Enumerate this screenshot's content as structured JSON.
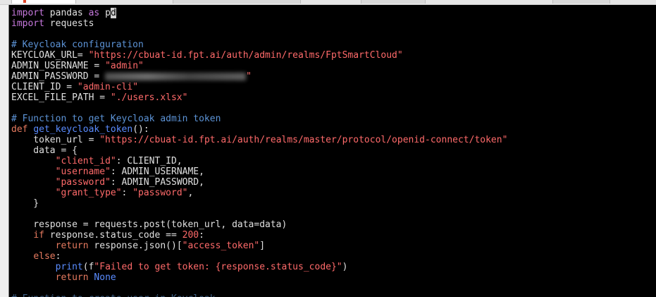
{
  "editor": {
    "lines": [
      {
        "segments": [
          {
            "t": "import",
            "c": "kw"
          },
          {
            "t": " pandas ",
            "c": "fn"
          },
          {
            "t": "as",
            "c": "kw"
          },
          {
            "t": " p",
            "c": "fn"
          },
          {
            "t": "d",
            "c": "cursor"
          }
        ]
      },
      {
        "segments": [
          {
            "t": "import",
            "c": "kw"
          },
          {
            "t": " requests",
            "c": "fn"
          }
        ]
      },
      {
        "segments": []
      },
      {
        "segments": [
          {
            "t": "# Keycloak configuration",
            "c": "cm"
          }
        ]
      },
      {
        "segments": [
          {
            "t": "KEYCLOAK_URL= ",
            "c": "fn"
          },
          {
            "t": "\"https://cbuat-id.fpt.ai/auth/admin/realms/FptSmartCloud\"",
            "c": "st"
          }
        ]
      },
      {
        "segments": [
          {
            "t": "ADMIN_USERNAME = ",
            "c": "fn"
          },
          {
            "t": "\"admin\"",
            "c": "st"
          }
        ]
      },
      {
        "segments": [
          {
            "t": "ADMIN_PASSWORD = ",
            "c": "fn"
          },
          {
            "t": "",
            "c": "blur"
          },
          {
            "t": "\"",
            "c": "st"
          }
        ]
      },
      {
        "segments": [
          {
            "t": "CLIENT_ID = ",
            "c": "fn"
          },
          {
            "t": "\"admin-cli\"",
            "c": "st"
          }
        ]
      },
      {
        "segments": [
          {
            "t": "EXCEL_FILE_PATH = ",
            "c": "fn"
          },
          {
            "t": "\"./users.xlsx\"",
            "c": "st"
          }
        ]
      },
      {
        "segments": []
      },
      {
        "segments": [
          {
            "t": "# Function to get Keycloak admin token",
            "c": "cm"
          }
        ]
      },
      {
        "segments": [
          {
            "t": "def",
            "c": "kw2"
          },
          {
            "t": " ",
            "c": "fn"
          },
          {
            "t": "get_keycloak_token",
            "c": "call"
          },
          {
            "t": "():",
            "c": "fn"
          }
        ]
      },
      {
        "segments": [
          {
            "t": "    token_url = ",
            "c": "fn"
          },
          {
            "t": "\"https://cbuat-id.fpt.ai/auth/realms/master/protocol/openid-connect/token\"",
            "c": "st"
          }
        ]
      },
      {
        "segments": [
          {
            "t": "    data = {",
            "c": "fn"
          }
        ]
      },
      {
        "segments": [
          {
            "t": "        ",
            "c": "fn"
          },
          {
            "t": "\"client_id\"",
            "c": "st"
          },
          {
            "t": ": CLIENT_ID,",
            "c": "fn"
          }
        ]
      },
      {
        "segments": [
          {
            "t": "        ",
            "c": "fn"
          },
          {
            "t": "\"username\"",
            "c": "st"
          },
          {
            "t": ": ADMIN_USERNAME,",
            "c": "fn"
          }
        ]
      },
      {
        "segments": [
          {
            "t": "        ",
            "c": "fn"
          },
          {
            "t": "\"password\"",
            "c": "st"
          },
          {
            "t": ": ADMIN_PASSWORD,",
            "c": "fn"
          }
        ]
      },
      {
        "segments": [
          {
            "t": "        ",
            "c": "fn"
          },
          {
            "t": "\"grant_type\"",
            "c": "st"
          },
          {
            "t": ": ",
            "c": "fn"
          },
          {
            "t": "\"password\"",
            "c": "st"
          },
          {
            "t": ",",
            "c": "fn"
          }
        ]
      },
      {
        "segments": [
          {
            "t": "    }",
            "c": "fn"
          }
        ]
      },
      {
        "segments": []
      },
      {
        "segments": [
          {
            "t": "    response = requests.post(token_url, data=data)",
            "c": "fn"
          }
        ]
      },
      {
        "segments": [
          {
            "t": "    ",
            "c": "fn"
          },
          {
            "t": "if",
            "c": "kw2"
          },
          {
            "t": " response.status_code == ",
            "c": "fn"
          },
          {
            "t": "200",
            "c": "num"
          },
          {
            "t": ":",
            "c": "fn"
          }
        ]
      },
      {
        "segments": [
          {
            "t": "        ",
            "c": "fn"
          },
          {
            "t": "return",
            "c": "kw2"
          },
          {
            "t": " response.json()[",
            "c": "fn"
          },
          {
            "t": "\"access_token\"",
            "c": "st"
          },
          {
            "t": "]",
            "c": "fn"
          }
        ]
      },
      {
        "segments": [
          {
            "t": "    ",
            "c": "fn"
          },
          {
            "t": "else",
            "c": "kw2"
          },
          {
            "t": ":",
            "c": "fn"
          }
        ]
      },
      {
        "segments": [
          {
            "t": "        ",
            "c": "fn"
          },
          {
            "t": "print",
            "c": "call"
          },
          {
            "t": "(f",
            "c": "fn"
          },
          {
            "t": "\"Failed to get token: {response.status_code}\"",
            "c": "st"
          },
          {
            "t": ")",
            "c": "fn"
          }
        ]
      },
      {
        "segments": [
          {
            "t": "        ",
            "c": "fn"
          },
          {
            "t": "return",
            "c": "kw2"
          },
          {
            "t": " ",
            "c": "fn"
          },
          {
            "t": "None",
            "c": "call"
          }
        ]
      },
      {
        "segments": []
      },
      {
        "segments": [
          {
            "t": "# Function to create user in Keycloak",
            "c": "partial"
          }
        ]
      }
    ]
  }
}
